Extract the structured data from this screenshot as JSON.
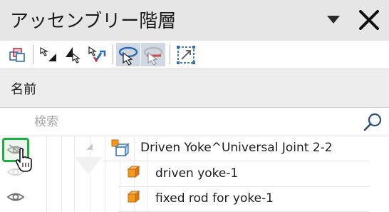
{
  "panel": {
    "title": "アッセンブリー階層",
    "column_header": "名前",
    "search_placeholder": "検索"
  },
  "toolbar": {
    "buttons": [
      {
        "name": "assembly-cube-icon",
        "active": false
      },
      {
        "name": "select-arrow-down-icon",
        "active": false
      },
      {
        "name": "select-arrow-right-icon",
        "active": false
      },
      {
        "name": "select-tool-icon",
        "active": false
      },
      {
        "name": "rotate-select-icon",
        "active": true
      },
      {
        "name": "rotate-deselect-icon",
        "active": true
      },
      {
        "name": "fit-frame-icon",
        "active": false
      }
    ]
  },
  "tree": {
    "rows": [
      {
        "label": "Driven Yoke^Universal Joint 2-2",
        "type": "subassembly",
        "expanded": true,
        "visibility": "hidden-hover"
      },
      {
        "label": "driven yoke-1",
        "type": "part",
        "visibility": "inherited"
      },
      {
        "label": "fixed rod for yoke-1",
        "type": "part",
        "visibility": "visible"
      }
    ]
  },
  "colors": {
    "accent_blue": "#2f6db3",
    "part_orange": "#f39a1e",
    "highlight_green": "#1db041",
    "title_bg": "#e6e6e6",
    "header_bg": "#ededed"
  }
}
